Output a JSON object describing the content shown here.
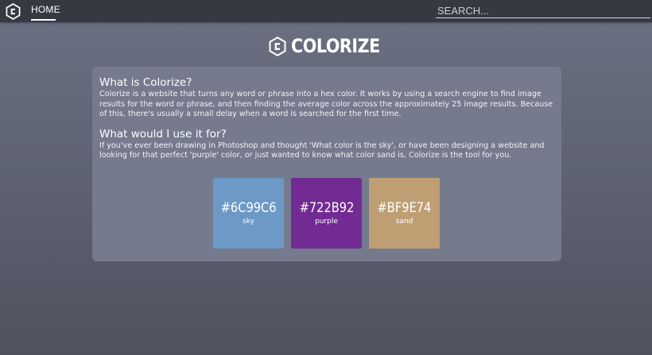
{
  "nav": {
    "home_label": "HOME",
    "logo_icon": "hexagon-c-logo-icon"
  },
  "search": {
    "placeholder": "SEARCH..."
  },
  "brand": {
    "title": "COLORIZE",
    "logo_icon": "hexagon-c-logo-icon"
  },
  "sections": [
    {
      "heading": "What is Colorize?",
      "text": "Colorize is a website that turns any word or phrase into a hex color. It works by using a search engine to find image results for the word or phrase, and then finding the average color across the approximately 25 image results. Because of this, there's usually a small delay when a word is searched for the first time."
    },
    {
      "heading": "What would I use it for?",
      "text": "If you've ever been drawing in Photoshop and thought 'What color is the sky', or have been designing a website and looking for that perfect 'purple' color, or just wanted to know what color sand is, Colorize is the tool for you."
    }
  ],
  "swatches": [
    {
      "hex": "#6C99C6",
      "label": "sky",
      "color": "#6C99C6"
    },
    {
      "hex": "#722B92",
      "label": "purple",
      "color": "#722B92"
    },
    {
      "hex": "#BF9E74",
      "label": "sand",
      "color": "#BF9E74"
    }
  ],
  "colors": {
    "navbar": "#353942",
    "card": "#757a8d"
  }
}
